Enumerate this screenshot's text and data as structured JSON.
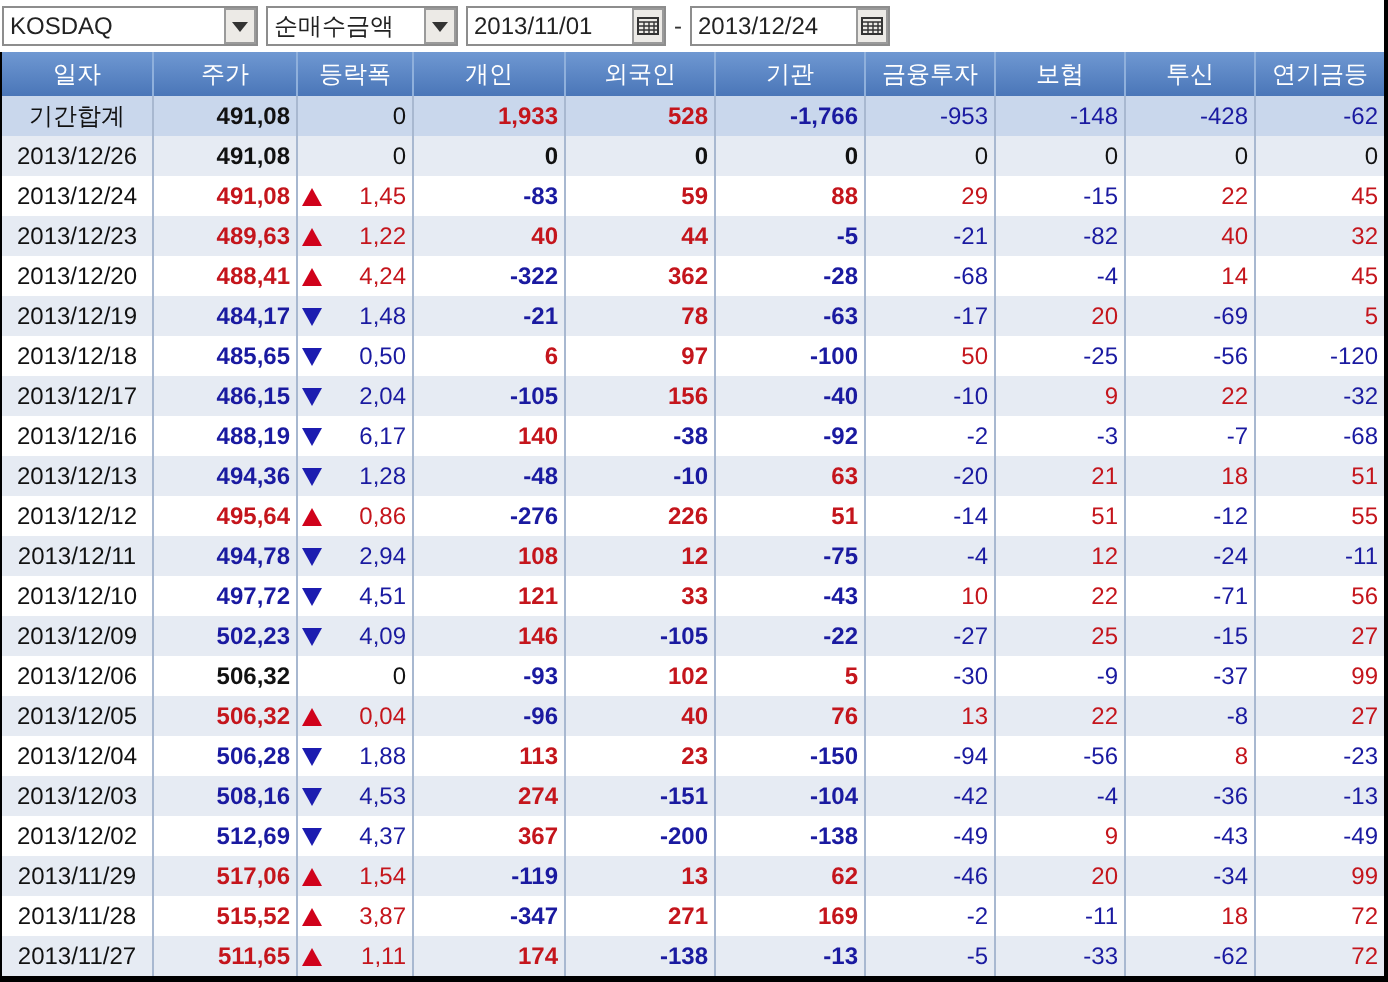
{
  "toolbar": {
    "market": "KOSDAQ",
    "measure": "순매수금액",
    "date_from": "2013/11/01",
    "separator": "-",
    "date_to": "2013/12/24"
  },
  "table": {
    "columns": [
      "일자",
      "주가",
      "등락폭",
      "개인",
      "외국인",
      "기관",
      "금융투자",
      "보험",
      "투신",
      "연기금등"
    ],
    "summary": {
      "date": "기간합계",
      "price": "491,08",
      "change": "0",
      "values": [
        "1,933",
        "528",
        "-1,766",
        "-953",
        "-148",
        "-428",
        "-62"
      ]
    },
    "rows": [
      {
        "date": "2013/12/26",
        "price": "491,08",
        "rise": false,
        "fall": false,
        "change": "0",
        "values": [
          "0",
          "0",
          "0",
          "0",
          "0",
          "0",
          "0"
        ]
      },
      {
        "date": "2013/12/24",
        "price": "491,08",
        "rise": true,
        "fall": false,
        "change": "1,45",
        "values": [
          "-83",
          "59",
          "88",
          "29",
          "-15",
          "22",
          "45"
        ]
      },
      {
        "date": "2013/12/23",
        "price": "489,63",
        "rise": true,
        "fall": false,
        "change": "1,22",
        "values": [
          "40",
          "44",
          "-5",
          "-21",
          "-82",
          "40",
          "32"
        ]
      },
      {
        "date": "2013/12/20",
        "price": "488,41",
        "rise": true,
        "fall": false,
        "change": "4,24",
        "values": [
          "-322",
          "362",
          "-28",
          "-68",
          "-4",
          "14",
          "45"
        ]
      },
      {
        "date": "2013/12/19",
        "price": "484,17",
        "rise": false,
        "fall": true,
        "change": "1,48",
        "values": [
          "-21",
          "78",
          "-63",
          "-17",
          "20",
          "-69",
          "5"
        ]
      },
      {
        "date": "2013/12/18",
        "price": "485,65",
        "rise": false,
        "fall": true,
        "change": "0,50",
        "values": [
          "6",
          "97",
          "-100",
          "50",
          "-25",
          "-56",
          "-120"
        ]
      },
      {
        "date": "2013/12/17",
        "price": "486,15",
        "rise": false,
        "fall": true,
        "change": "2,04",
        "values": [
          "-105",
          "156",
          "-40",
          "-10",
          "9",
          "22",
          "-32"
        ]
      },
      {
        "date": "2013/12/16",
        "price": "488,19",
        "rise": false,
        "fall": true,
        "change": "6,17",
        "values": [
          "140",
          "-38",
          "-92",
          "-2",
          "-3",
          "-7",
          "-68"
        ]
      },
      {
        "date": "2013/12/13",
        "price": "494,36",
        "rise": false,
        "fall": true,
        "change": "1,28",
        "values": [
          "-48",
          "-10",
          "63",
          "-20",
          "21",
          "18",
          "51"
        ]
      },
      {
        "date": "2013/12/12",
        "price": "495,64",
        "rise": true,
        "fall": false,
        "change": "0,86",
        "values": [
          "-276",
          "226",
          "51",
          "-14",
          "51",
          "-12",
          "55"
        ]
      },
      {
        "date": "2013/12/11",
        "price": "494,78",
        "rise": false,
        "fall": true,
        "change": "2,94",
        "values": [
          "108",
          "12",
          "-75",
          "-4",
          "12",
          "-24",
          "-11"
        ]
      },
      {
        "date": "2013/12/10",
        "price": "497,72",
        "rise": false,
        "fall": true,
        "change": "4,51",
        "values": [
          "121",
          "33",
          "-43",
          "10",
          "22",
          "-71",
          "56"
        ]
      },
      {
        "date": "2013/12/09",
        "price": "502,23",
        "rise": false,
        "fall": true,
        "change": "4,09",
        "values": [
          "146",
          "-105",
          "-22",
          "-27",
          "25",
          "-15",
          "27"
        ]
      },
      {
        "date": "2013/12/06",
        "price": "506,32",
        "rise": false,
        "fall": false,
        "change": "0",
        "values": [
          "-93",
          "102",
          "5",
          "-30",
          "-9",
          "-37",
          "99"
        ]
      },
      {
        "date": "2013/12/05",
        "price": "506,32",
        "rise": true,
        "fall": false,
        "change": "0,04",
        "values": [
          "-96",
          "40",
          "76",
          "13",
          "22",
          "-8",
          "27"
        ]
      },
      {
        "date": "2013/12/04",
        "price": "506,28",
        "rise": false,
        "fall": true,
        "change": "1,88",
        "values": [
          "113",
          "23",
          "-150",
          "-94",
          "-56",
          "8",
          "-23"
        ]
      },
      {
        "date": "2013/12/03",
        "price": "508,16",
        "rise": false,
        "fall": true,
        "change": "4,53",
        "values": [
          "274",
          "-151",
          "-104",
          "-42",
          "-4",
          "-36",
          "-13"
        ]
      },
      {
        "date": "2013/12/02",
        "price": "512,69",
        "rise": false,
        "fall": true,
        "change": "4,37",
        "values": [
          "367",
          "-200",
          "-138",
          "-49",
          "9",
          "-43",
          "-49"
        ]
      },
      {
        "date": "2013/11/29",
        "price": "517,06",
        "rise": true,
        "fall": false,
        "change": "1,54",
        "values": [
          "-119",
          "13",
          "62",
          "-46",
          "20",
          "-34",
          "99"
        ]
      },
      {
        "date": "2013/11/28",
        "price": "515,52",
        "rise": true,
        "fall": false,
        "change": "3,87",
        "values": [
          "-347",
          "271",
          "169",
          "-2",
          "-11",
          "18",
          "72"
        ]
      },
      {
        "date": "2013/11/27",
        "price": "511,65",
        "rise": true,
        "fall": false,
        "change": "1,11",
        "values": [
          "174",
          "-138",
          "-13",
          "-5",
          "-33",
          "-62",
          "72"
        ]
      }
    ]
  }
}
